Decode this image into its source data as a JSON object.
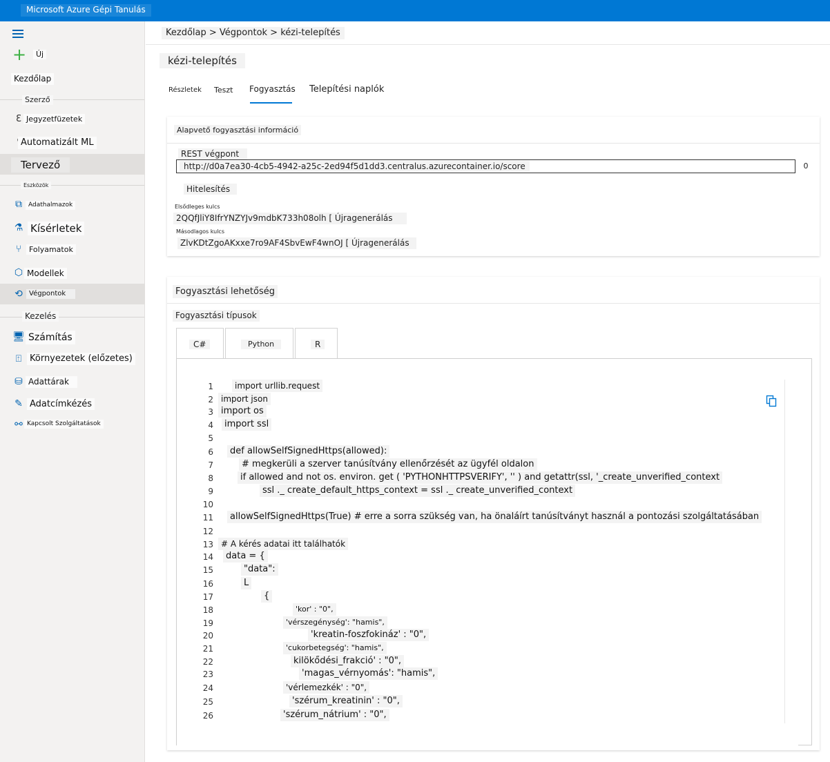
{
  "app": {
    "title": "Microsoft Azure Gépi Tanulás"
  },
  "sidebar": {
    "new_label": "Új",
    "home_label": "Kezdőlap",
    "sections": {
      "author": "Szerző",
      "assets": "Eszközök",
      "manage": "Kezelés"
    },
    "items": {
      "notebooks": "Jegyzetfüzetek",
      "automl": "Automatizált ML",
      "designer": "Tervező",
      "datasets": "Adathalmazok",
      "experiments": "Kísérletek",
      "pipelines": "Folyamatok",
      "models": "Modellek",
      "endpoints": "Végpontok",
      "compute": "Számítás",
      "environments": "Környezetek (előzetes)",
      "datastores": "Adattárak",
      "labeling": "Adatcímkézés",
      "linked": "Kapcsolt Szolgáltatások"
    }
  },
  "breadcrumb": "Kezdőlap > Végpontok > kézi-telepítés",
  "page_title": "kézi-telepítés",
  "tabs": {
    "details": "Részletek",
    "test": "Teszt",
    "consume": "Fogyasztás",
    "logs": "Telepítési naplók"
  },
  "consume_info": {
    "heading": "Alapvető fogyasztási információ",
    "rest_label": "REST végpont",
    "rest_url": "http://d0a7ea30-4cb5-4942-a25c-2ed94f5d1dd3.centralus.azurecontainer.io/score",
    "copy_glyph": "0",
    "auth_label": "Hitelesítés",
    "primary_label": "Elsődleges kulcs",
    "primary_value": "2QQfJliY8IfrYNZYJv9mdbK733h08olh [ Újragenerálás",
    "secondary_label": "Másodlagos kulcs",
    "secondary_value": "ZlvKDtZgoAKxxe7ro9AF4SbvEwF4wnOJ [ Újragenerálás"
  },
  "consume_option": {
    "heading": "Fogyasztási lehetőség",
    "types_label": "Fogyasztási típusok",
    "lang_tabs": {
      "csharp": "C#",
      "python": "Python",
      "r": "R"
    }
  },
  "code": {
    "line_numbers": [
      "1",
      "2",
      "3",
      "4",
      "5",
      "6",
      "7",
      "8",
      "9",
      "10",
      "11",
      "12",
      "13",
      "14",
      "15",
      "16",
      "17",
      "18",
      "19",
      "20",
      "21",
      "22",
      "23",
      "24",
      "25",
      "26"
    ],
    "lines": [
      "import urllib.request",
      "import json",
      "import os",
      "import ssl",
      "",
      "def allowSelfSignedHttps(allowed):",
      "# megkerüli a szerver tanúsítvány ellenőrzését az ügyfél oldalon",
      "if allowed and not os. environ. get ( 'PYTHONHTTPSVERIFY', '' ) and getattr(ssl, '_create_unverified_context",
      "ssl ._ create_default_https_context = ssl ._ create_unverified_context",
      "",
      "allowSelfSignedHttps(True) # erre a sorra szükség van, ha önaláírt tanúsítványt használ a pontozási szolgáltatásában",
      "",
      "# A kérés adatai itt találhatók",
      "data = {",
      "\"data\":",
      "L",
      "{",
      "'kor' : \"0\",",
      "'vérszegénység': \"hamis\",",
      "'kreatin-foszfokináz' : \"0\",",
      "'cukorbetegség': \"hamis\",",
      "kilökődési_frakció' : \"0\",",
      "'magas_vérnyomás': \"hamis\",",
      "'vérlemezkék' : \"0\",",
      "'szérum_kreatinin' : \"0\",",
      "'szérum_nátrium' : \"0\","
    ]
  },
  "colors": {
    "accent": "#0078d4",
    "sidebar_bg": "#f3f2f1"
  }
}
